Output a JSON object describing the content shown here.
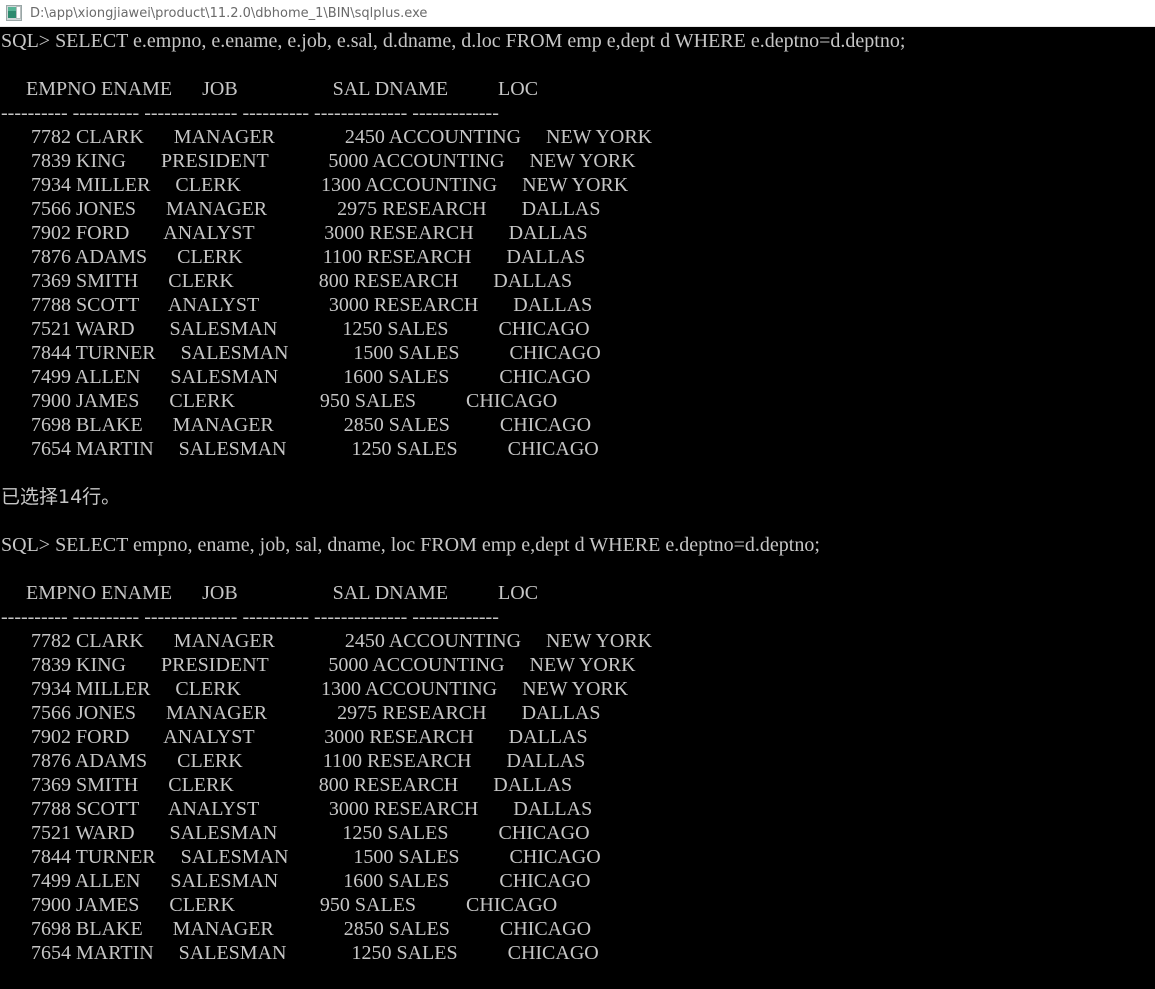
{
  "window": {
    "title": "D:\\app\\xiongjiawei\\product\\11.2.0\\dbhome_1\\BIN\\sqlplus.exe",
    "icon": "console-app-icon",
    "titlebar_bg": "#ffffff",
    "titlebar_fg": "#6a6a6a",
    "console_bg": "#000000",
    "console_fg": "#c6c6c6"
  },
  "console": {
    "prompt": "SQL> ",
    "blocks": [
      {
        "type": "command",
        "prompt": "SQL> ",
        "command": "SELECT e.empno, e.ename, e.job, e.sal, d.dname, d.loc FROM emp e,dept d WHERE e.deptno=d.deptno;"
      },
      {
        "type": "result",
        "headers": [
          "EMPNO",
          "ENAME",
          "JOB",
          "SAL",
          "DNAME",
          "LOC"
        ],
        "widths": [
          10,
          10,
          14,
          10,
          14,
          13
        ],
        "aligns": [
          "right",
          "left",
          "left",
          "right",
          "left",
          "left"
        ],
        "rules": [
          "----------",
          "----------",
          "--------------",
          "----------",
          "--------------",
          "-------------"
        ],
        "rows": [
          [
            "7782",
            "CLARK",
            "MANAGER",
            "2450",
            "ACCOUNTING",
            "NEW YORK"
          ],
          [
            "7839",
            "KING",
            "PRESIDENT",
            "5000",
            "ACCOUNTING",
            "NEW YORK"
          ],
          [
            "7934",
            "MILLER",
            "CLERK",
            "1300",
            "ACCOUNTING",
            "NEW YORK"
          ],
          [
            "7566",
            "JONES",
            "MANAGER",
            "2975",
            "RESEARCH",
            "DALLAS"
          ],
          [
            "7902",
            "FORD",
            "ANALYST",
            "3000",
            "RESEARCH",
            "DALLAS"
          ],
          [
            "7876",
            "ADAMS",
            "CLERK",
            "1100",
            "RESEARCH",
            "DALLAS"
          ],
          [
            "7369",
            "SMITH",
            "CLERK",
            "800",
            "RESEARCH",
            "DALLAS"
          ],
          [
            "7788",
            "SCOTT",
            "ANALYST",
            "3000",
            "RESEARCH",
            "DALLAS"
          ],
          [
            "7521",
            "WARD",
            "SALESMAN",
            "1250",
            "SALES",
            "CHICAGO"
          ],
          [
            "7844",
            "TURNER",
            "SALESMAN",
            "1500",
            "SALES",
            "CHICAGO"
          ],
          [
            "7499",
            "ALLEN",
            "SALESMAN",
            "1600",
            "SALES",
            "CHICAGO"
          ],
          [
            "7900",
            "JAMES",
            "CLERK",
            "950",
            "SALES",
            "CHICAGO"
          ],
          [
            "7698",
            "BLAKE",
            "MANAGER",
            "2850",
            "SALES",
            "CHICAGO"
          ],
          [
            "7654",
            "MARTIN",
            "SALESMAN",
            "1250",
            "SALES",
            "CHICAGO"
          ]
        ]
      },
      {
        "type": "message",
        "text": "已选择14行。"
      },
      {
        "type": "command",
        "prompt": "SQL> ",
        "command": "SELECT empno, ename, job, sal, dname, loc FROM emp e,dept d WHERE e.deptno=d.deptno;"
      },
      {
        "type": "result",
        "headers": [
          "EMPNO",
          "ENAME",
          "JOB",
          "SAL",
          "DNAME",
          "LOC"
        ],
        "widths": [
          10,
          10,
          14,
          10,
          14,
          13
        ],
        "aligns": [
          "right",
          "left",
          "left",
          "right",
          "left",
          "left"
        ],
        "rules": [
          "----------",
          "----------",
          "--------------",
          "----------",
          "--------------",
          "-------------"
        ],
        "rows": [
          [
            "7782",
            "CLARK",
            "MANAGER",
            "2450",
            "ACCOUNTING",
            "NEW YORK"
          ],
          [
            "7839",
            "KING",
            "PRESIDENT",
            "5000",
            "ACCOUNTING",
            "NEW YORK"
          ],
          [
            "7934",
            "MILLER",
            "CLERK",
            "1300",
            "ACCOUNTING",
            "NEW YORK"
          ],
          [
            "7566",
            "JONES",
            "MANAGER",
            "2975",
            "RESEARCH",
            "DALLAS"
          ],
          [
            "7902",
            "FORD",
            "ANALYST",
            "3000",
            "RESEARCH",
            "DALLAS"
          ],
          [
            "7876",
            "ADAMS",
            "CLERK",
            "1100",
            "RESEARCH",
            "DALLAS"
          ],
          [
            "7369",
            "SMITH",
            "CLERK",
            "800",
            "RESEARCH",
            "DALLAS"
          ],
          [
            "7788",
            "SCOTT",
            "ANALYST",
            "3000",
            "RESEARCH",
            "DALLAS"
          ],
          [
            "7521",
            "WARD",
            "SALESMAN",
            "1250",
            "SALES",
            "CHICAGO"
          ],
          [
            "7844",
            "TURNER",
            "SALESMAN",
            "1500",
            "SALES",
            "CHICAGO"
          ],
          [
            "7499",
            "ALLEN",
            "SALESMAN",
            "1600",
            "SALES",
            "CHICAGO"
          ],
          [
            "7900",
            "JAMES",
            "CLERK",
            "950",
            "SALES",
            "CHICAGO"
          ],
          [
            "7698",
            "BLAKE",
            "MANAGER",
            "2850",
            "SALES",
            "CHICAGO"
          ],
          [
            "7654",
            "MARTIN",
            "SALESMAN",
            "1250",
            "SALES",
            "CHICAGO"
          ]
        ]
      }
    ]
  }
}
